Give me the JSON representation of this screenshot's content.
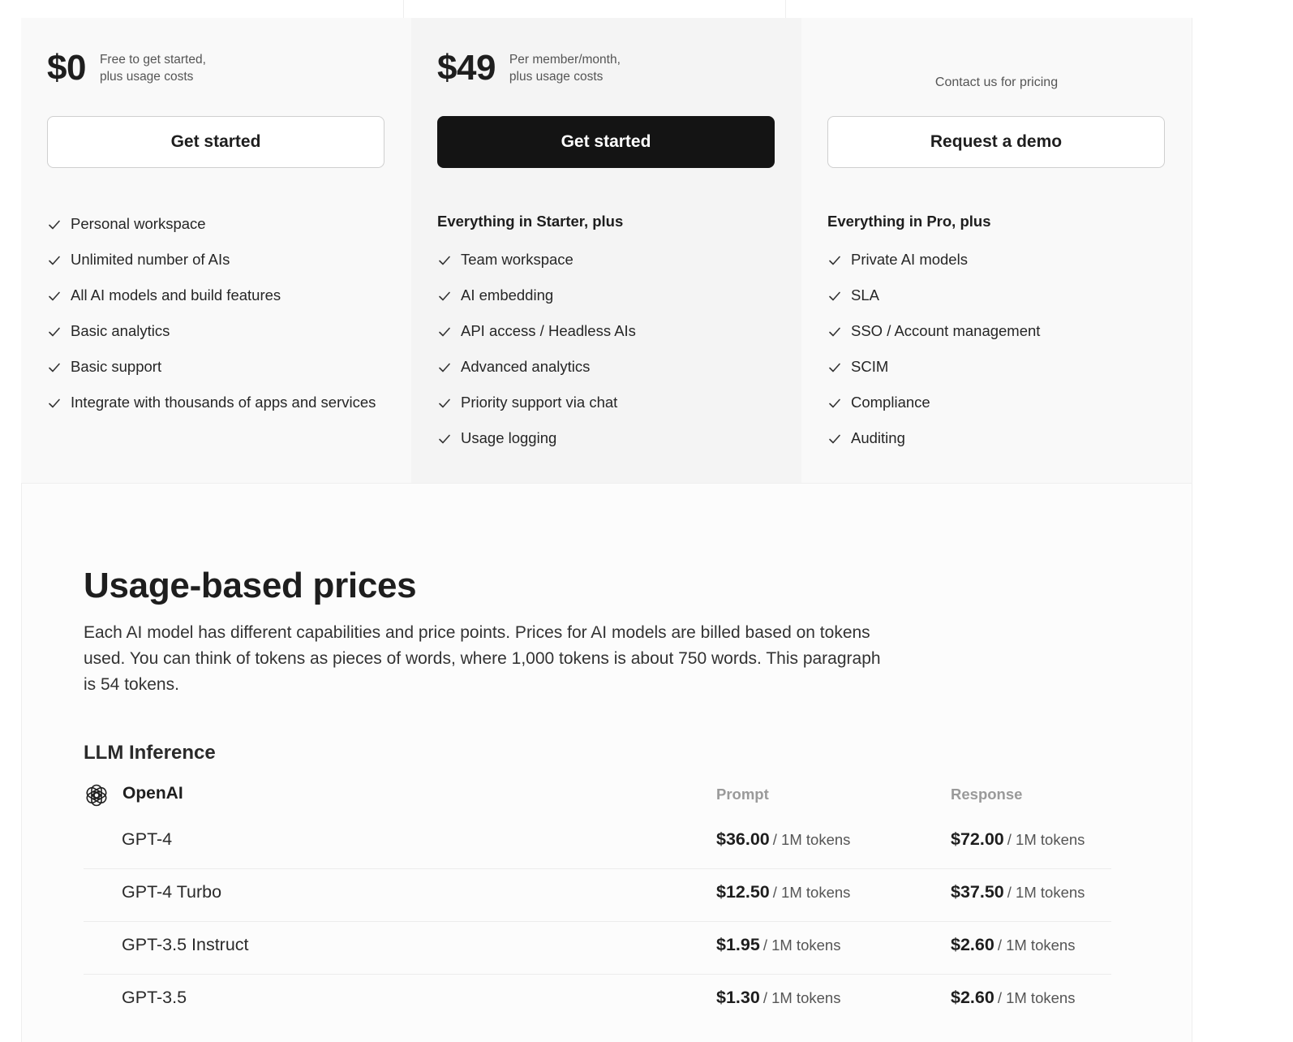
{
  "plans": [
    {
      "price": "$0",
      "note_line1": "Free to get started,",
      "note_line2": "plus usage costs",
      "button": "Get started",
      "features_heading": "",
      "features": [
        "Personal workspace",
        "Unlimited number of AIs",
        "All AI models and build features",
        "Basic analytics",
        "Basic support",
        "Integrate with thousands of apps and services"
      ]
    },
    {
      "price": "$49",
      "note_line1": "Per member/month,",
      "note_line2": "plus usage costs",
      "button": "Get started",
      "features_heading": "Everything in Starter, plus",
      "features": [
        "Team workspace",
        "AI embedding",
        "API access / Headless AIs",
        "Advanced analytics",
        "Priority support via chat",
        "Usage logging"
      ]
    },
    {
      "contact": "Contact us for pricing",
      "button": "Request a demo",
      "features_heading": "Everything in Pro, plus",
      "features": [
        "Private AI models",
        "SLA",
        "SSO / Account management",
        "SCIM",
        "Compliance",
        "Auditing"
      ]
    }
  ],
  "usage": {
    "title": "Usage-based prices",
    "lead": "Each AI model has different capabilities and price points. Prices for AI models are billed based on tokens used. You can think of tokens as pieces of words, where 1,000 tokens is about 750 words. This paragraph is 54 tokens.",
    "section": "LLM Inference",
    "provider": {
      "name": "OpenAI",
      "icon": "openai-logo-icon",
      "col_prompt": "Prompt",
      "col_response": "Response",
      "unit": "/ 1M tokens",
      "models": [
        {
          "name": "GPT-4",
          "prompt": "$36.00",
          "response": "$72.00"
        },
        {
          "name": "GPT-4 Turbo",
          "prompt": "$12.50",
          "response": "$37.50"
        },
        {
          "name": "GPT-3.5 Instruct",
          "prompt": "$1.95",
          "response": "$2.60"
        },
        {
          "name": "GPT-3.5",
          "prompt": "$1.30",
          "response": "$2.60"
        }
      ]
    }
  },
  "colors": {
    "primary_button": "#141414",
    "pro_background": "#f4f4f4",
    "muted_text": "#555555"
  }
}
